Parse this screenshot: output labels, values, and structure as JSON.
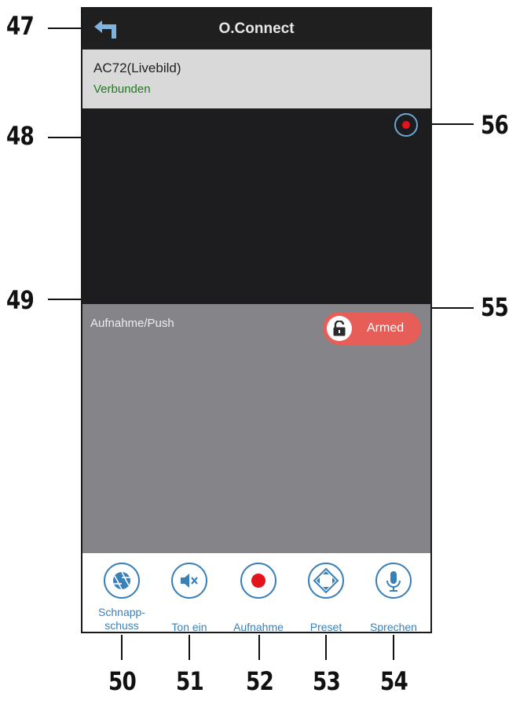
{
  "callouts": {
    "c47": "47",
    "c48": "48",
    "c49": "49",
    "c50": "50",
    "c51": "51",
    "c52": "52",
    "c53": "53",
    "c54": "54",
    "c55": "55",
    "c56": "56"
  },
  "header": {
    "title": "O.Connect",
    "back_icon": "back-arrow-icon"
  },
  "device": {
    "name": "AC72(Livebild)",
    "status": "Verbunden",
    "status_color": "#1e7a1e"
  },
  "video": {
    "record_indicator": "record-indicator-icon",
    "indicator_color": "#e3141b"
  },
  "events": {
    "label": "Aufnahme/Push",
    "armed_toggle": {
      "label": "Armed",
      "icon": "unlock-icon",
      "color": "#e65e57"
    }
  },
  "toolbar": {
    "accent": "#3a80b8",
    "items": [
      {
        "label": "Schnapp-\nschuss",
        "icon": "shutter-icon"
      },
      {
        "label": "Ton ein",
        "icon": "mute-speaker-icon"
      },
      {
        "label": "Aufnahme",
        "icon": "record-icon"
      },
      {
        "label": "Preset",
        "icon": "direction-pad-icon"
      },
      {
        "label": "Sprechen",
        "icon": "microphone-icon"
      }
    ]
  }
}
